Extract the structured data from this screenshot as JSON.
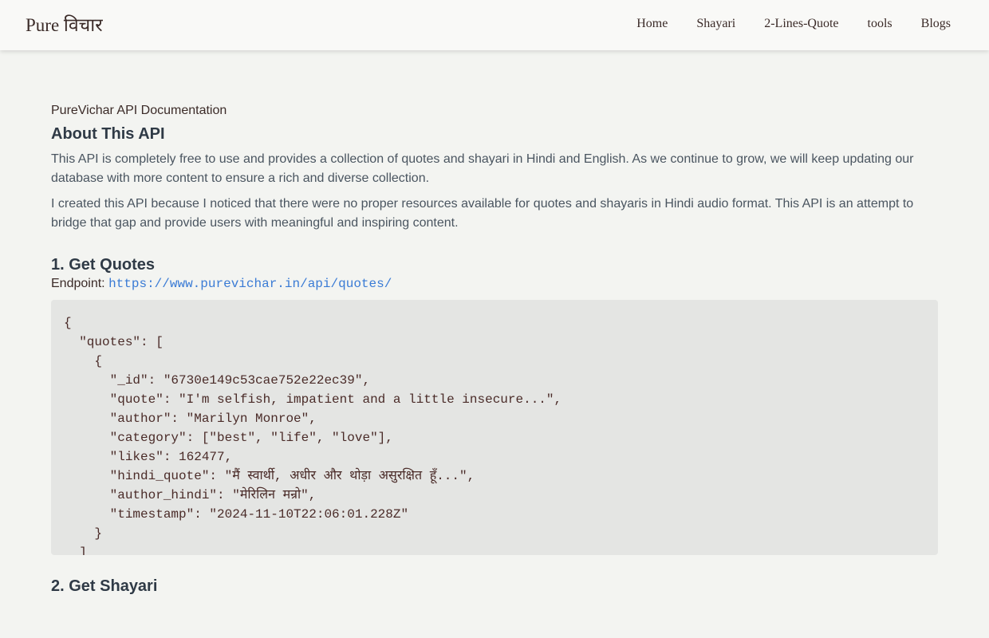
{
  "nav": {
    "brand": "Pure विचार",
    "links": [
      "Home",
      "Shayari",
      "2-Lines-Quote",
      "tools",
      "Blogs"
    ]
  },
  "doc": {
    "label": "PureVichar API Documentation",
    "about_title": "About This API",
    "about_p1": "This API is completely free to use and provides a collection of quotes and shayari in Hindi and English. As we continue to grow, we will keep updating our database with more content to ensure a rich and diverse collection.",
    "about_p2": "I created this API because I noticed that there were no proper resources available for quotes and shayaris in Hindi audio format. This API is an attempt to bridge that gap and provide users with meaningful and inspiring content."
  },
  "section1": {
    "title": "1. Get Quotes",
    "endpoint_label": "Endpoint:",
    "endpoint_url": "https://www.purevichar.in/api/quotes/",
    "code": "{\n  \"quotes\": [\n    {\n      \"_id\": \"6730e149c53cae752e22ec39\",\n      \"quote\": \"I'm selfish, impatient and a little insecure...\",\n      \"author\": \"Marilyn Monroe\",\n      \"category\": [\"best\", \"life\", \"love\"],\n      \"likes\": 162477,\n      \"hindi_quote\": \"मैं स्वार्थी, अधीर और थोड़ा असुरक्षित हूँ...\",\n      \"author_hindi\": \"मेरिलिन मन्रो\",\n      \"timestamp\": \"2024-11-10T22:06:01.228Z\"\n    }\n  ]\n}"
  },
  "section2": {
    "title": "2. Get Shayari"
  }
}
